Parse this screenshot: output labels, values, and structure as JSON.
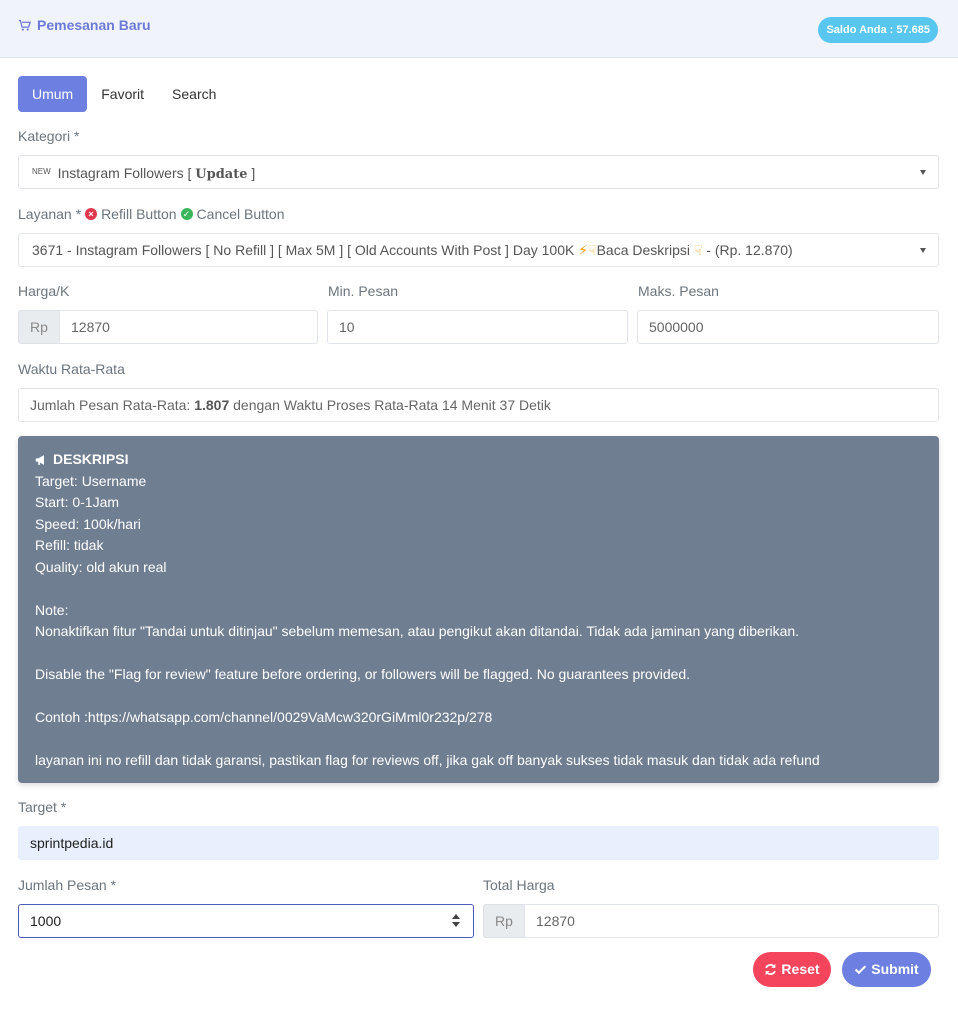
{
  "header": {
    "title": "Pemesanan Baru",
    "saldo": "Saldo Anda : 57.685"
  },
  "tabs": [
    {
      "label": "Umum",
      "active": true
    },
    {
      "label": "Favorit",
      "active": false
    },
    {
      "label": "Search",
      "active": false
    }
  ],
  "kategori": {
    "label": "Kategori *",
    "badge": "NEW",
    "value_prefix": "Instagram Followers [",
    "value_bold": "Update",
    "value_suffix": "]"
  },
  "layanan": {
    "label": "Layanan *",
    "refill_label": "Refill Button",
    "cancel_label": "Cancel Button",
    "value_a": "3671 - Instagram Followers [ No Refill ] [ Max 5M ] [ Old Accounts With Post ] Day 100K",
    "value_b": "Baca Deskripsi",
    "value_c": "- (Rp. 12.870)"
  },
  "harga": {
    "label": "Harga/K",
    "addon": "Rp",
    "value": "12870"
  },
  "min_pesan": {
    "label": "Min. Pesan",
    "value": "10"
  },
  "maks_pesan": {
    "label": "Maks. Pesan",
    "value": "5000000"
  },
  "waktu": {
    "label": "Waktu Rata-Rata",
    "prefix": "Jumlah Pesan Rata-Rata:",
    "count": "1.807",
    "suffix": "dengan Waktu Proses Rata-Rata 14 Menit 37 Detik"
  },
  "deskripsi": {
    "title": "DESKRIPSI",
    "lines": [
      "Target: Username",
      "Start: 0-1Jam",
      "Speed: 100k/hari",
      "Refill: tidak",
      "Quality: old akun real",
      "",
      "Note:",
      "Nonaktifkan fitur \"Tandai untuk ditinjau\" sebelum memesan, atau pengikut akan ditandai. Tidak ada jaminan yang diberikan.",
      "",
      "Disable the \"Flag for review\" feature before ordering, or followers will be flagged. No guarantees provided.",
      "",
      "Contoh :https://whatsapp.com/channel/0029VaMcw320rGiMml0r232p/278",
      "",
      "layanan ini no refill dan tidak garansi, pastikan flag for reviews off, jika gak off banyak sukses tidak masuk dan tidak ada refund"
    ]
  },
  "target": {
    "label": "Target *",
    "value": "sprintpedia.id"
  },
  "jumlah": {
    "label": "Jumlah Pesan *",
    "value": "1000"
  },
  "total": {
    "label": "Total Harga",
    "addon": "Rp",
    "value": "12870"
  },
  "buttons": {
    "reset": "Reset",
    "submit": "Submit"
  },
  "colors": {
    "primary": "#6d7fe0",
    "danger": "#f5455c",
    "info": "#59c6f0",
    "desc_bg": "#707e91"
  }
}
